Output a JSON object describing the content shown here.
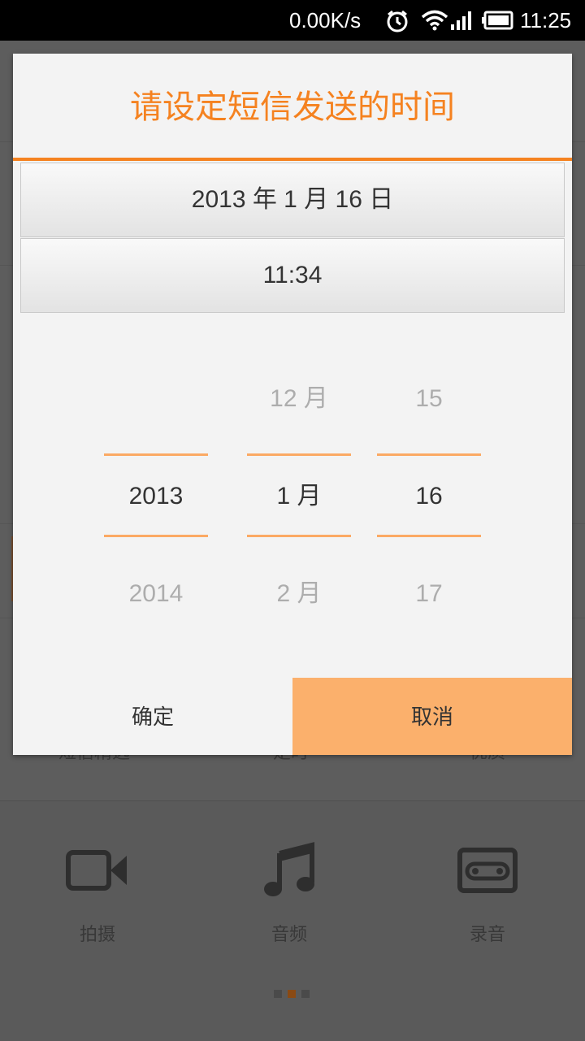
{
  "status_bar": {
    "network_speed": "0.00K/s",
    "time": "11:25",
    "icons": [
      "alarm-icon",
      "wifi-icon",
      "signal-icon",
      "battery-icon"
    ]
  },
  "background": {
    "partial_labels": [
      "短信精选",
      "定时",
      "优质"
    ],
    "tools": [
      {
        "icon": "video-camera-icon",
        "label": "拍摄"
      },
      {
        "icon": "music-note-icon",
        "label": "音频"
      },
      {
        "icon": "cassette-icon",
        "label": "录音"
      }
    ],
    "page_dots": 3,
    "active_dot": 1
  },
  "dialog": {
    "title": "请设定短信发送的时间",
    "date_button": "2013 年 1 月 16 日",
    "time_button": "11:34",
    "picker": {
      "year": {
        "prev": "",
        "current": "2013",
        "next": "2014"
      },
      "month": {
        "prev": "12 月",
        "current": "1 月",
        "next": "2 月"
      },
      "day": {
        "prev": "15",
        "current": "16",
        "next": "17"
      }
    },
    "ok_label": "确定",
    "cancel_label": "取消"
  },
  "colors": {
    "accent": "#f58220",
    "picker_line": "#fba964",
    "cancel_bg": "#fbb06c"
  }
}
